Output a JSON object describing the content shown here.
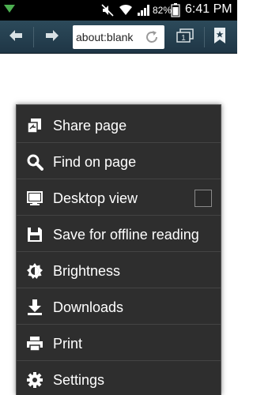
{
  "status_bar": {
    "battery_text": "82%",
    "time": "6:41 PM"
  },
  "toolbar": {
    "url": "about:blank"
  },
  "menu": {
    "items": [
      {
        "label": "Share page",
        "icon": "share-icon"
      },
      {
        "label": "Find on page",
        "icon": "search-icon"
      },
      {
        "label": "Desktop view",
        "icon": "desktop-icon",
        "checkbox": false
      },
      {
        "label": "Save for offline reading",
        "icon": "save-icon"
      },
      {
        "label": "Brightness",
        "icon": "brightness-icon"
      },
      {
        "label": "Downloads",
        "icon": "download-icon"
      },
      {
        "label": "Print",
        "icon": "print-icon"
      },
      {
        "label": "Settings",
        "icon": "gear-icon"
      }
    ]
  },
  "colors": {
    "status_bar_bg": "#000000",
    "toolbar_bg": "#263f4f",
    "menu_bg": "#2e2e2e",
    "menu_text": "#ffffff"
  }
}
